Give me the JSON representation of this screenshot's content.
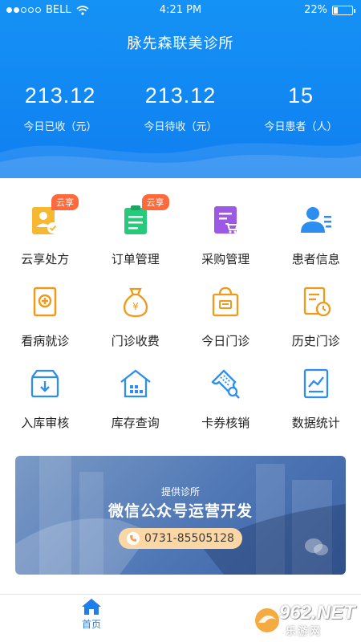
{
  "status_bar": {
    "carrier": "BELL",
    "time": "4:21 PM",
    "battery": "22%",
    "battery_level": 0.22
  },
  "header": {
    "title": "脉先森联美诊所"
  },
  "stats": [
    {
      "value": "213.12",
      "label": "今日已收（元）"
    },
    {
      "value": "213.12",
      "label": "今日待收（元）"
    },
    {
      "value": "15",
      "label": "今日患者（人）"
    }
  ],
  "grid": [
    {
      "label": "云享处方",
      "icon": "prescription-icon",
      "badge": "云享"
    },
    {
      "label": "订单管理",
      "icon": "order-icon",
      "badge": "云享"
    },
    {
      "label": "采购管理",
      "icon": "purchase-icon"
    },
    {
      "label": "患者信息",
      "icon": "patient-icon"
    },
    {
      "label": "看病就诊",
      "icon": "medical-visit-icon"
    },
    {
      "label": "门诊收费",
      "icon": "money-bag-icon"
    },
    {
      "label": "今日门诊",
      "icon": "today-clinic-icon"
    },
    {
      "label": "历史门诊",
      "icon": "history-clinic-icon"
    },
    {
      "label": "入库审核",
      "icon": "inbound-box-icon"
    },
    {
      "label": "库存查询",
      "icon": "warehouse-icon"
    },
    {
      "label": "卡券核销",
      "icon": "coupon-icon"
    },
    {
      "label": "数据统计",
      "icon": "stats-icon"
    }
  ],
  "banner": {
    "subtitle": "提供诊所",
    "title": "微信公众号运营开发",
    "phone": "0731-85505128"
  },
  "tabbar": {
    "home_label": "首页"
  },
  "watermark": {
    "number": "962.NET",
    "text": "乐游网"
  },
  "colors": {
    "primary": "#1592f5",
    "badge": "#ff6a3d",
    "tab_active": "#1f7eea"
  }
}
